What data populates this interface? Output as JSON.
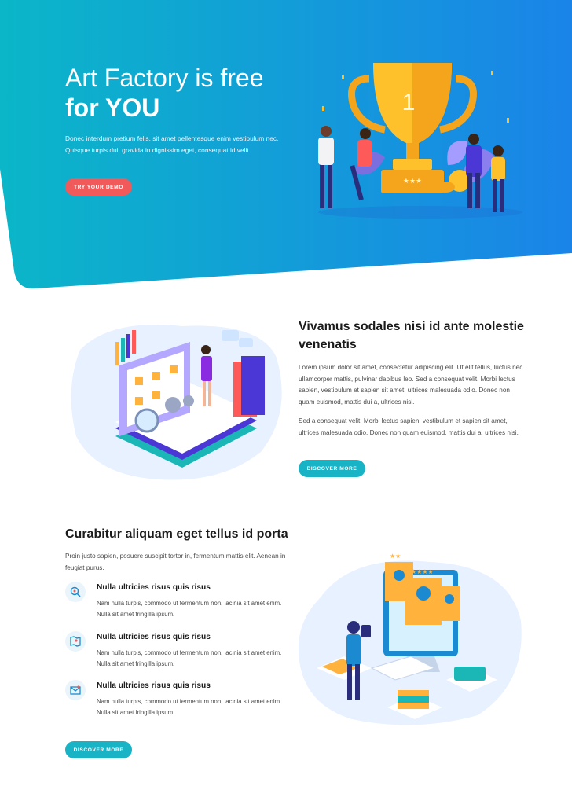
{
  "hero": {
    "title_line1": "Art Factory is free",
    "title_line2": "for YOU",
    "text": "Donec interdum pretium felis, sit amet pellentesque enim vestibulum nec. Quisque turpis dui, gravida in dignissim eget, consequat id velit.",
    "button": "TRY YOUR DEMO",
    "trophy_number": "1",
    "colors": {
      "gradient_start": "#0bb6c8",
      "gradient_end": "#1a84e8",
      "button": "#f05a5a"
    }
  },
  "section2": {
    "title": "Vivamus sodales nisi id ante molestie venenatis",
    "p1": "Lorem ipsum dolor sit amet, consectetur adipiscing elit. Ut elit tellus, luctus nec ullamcorper mattis, pulvinar dapibus leo. Sed a consequat velit. Morbi lectus sapien, vestibulum et sapien sit amet, ultrices malesuada odio. Donec non quam euismod, mattis dui a, ultrices nisi.",
    "p2": "Sed a consequat velit. Morbi lectus sapien, vestibulum et sapien sit amet, ultrices malesuada odio. Donec non quam euismod, mattis dui a, ultrices nisi.",
    "button": "DISCOVER MORE"
  },
  "section3": {
    "title": "Curabitur aliquam eget tellus id porta",
    "intro": "Proin justo sapien, posuere suscipit tortor in, fermentum mattis elit. Aenean in feugiat purus.",
    "features": [
      {
        "icon": "gear-search-icon",
        "title": "Nulla ultricies risus quis risus",
        "text": "Nam nulla turpis, commodo ut fermentum non, lacinia sit amet enim. Nulla sit amet fringilla ipsum."
      },
      {
        "icon": "map-icon",
        "title": "Nulla ultricies risus quis risus",
        "text": "Nam nulla turpis, commodo ut fermentum non, lacinia sit amet enim. Nulla sit amet fringilla ipsum."
      },
      {
        "icon": "mail-icon",
        "title": "Nulla ultricies risus quis risus",
        "text": "Nam nulla turpis, commodo ut fermentum non, lacinia sit amet enim. Nulla sit amet fringilla ipsum."
      }
    ],
    "button": "DISCOVER MORE",
    "colors": {
      "button": "#19b3c6"
    }
  }
}
